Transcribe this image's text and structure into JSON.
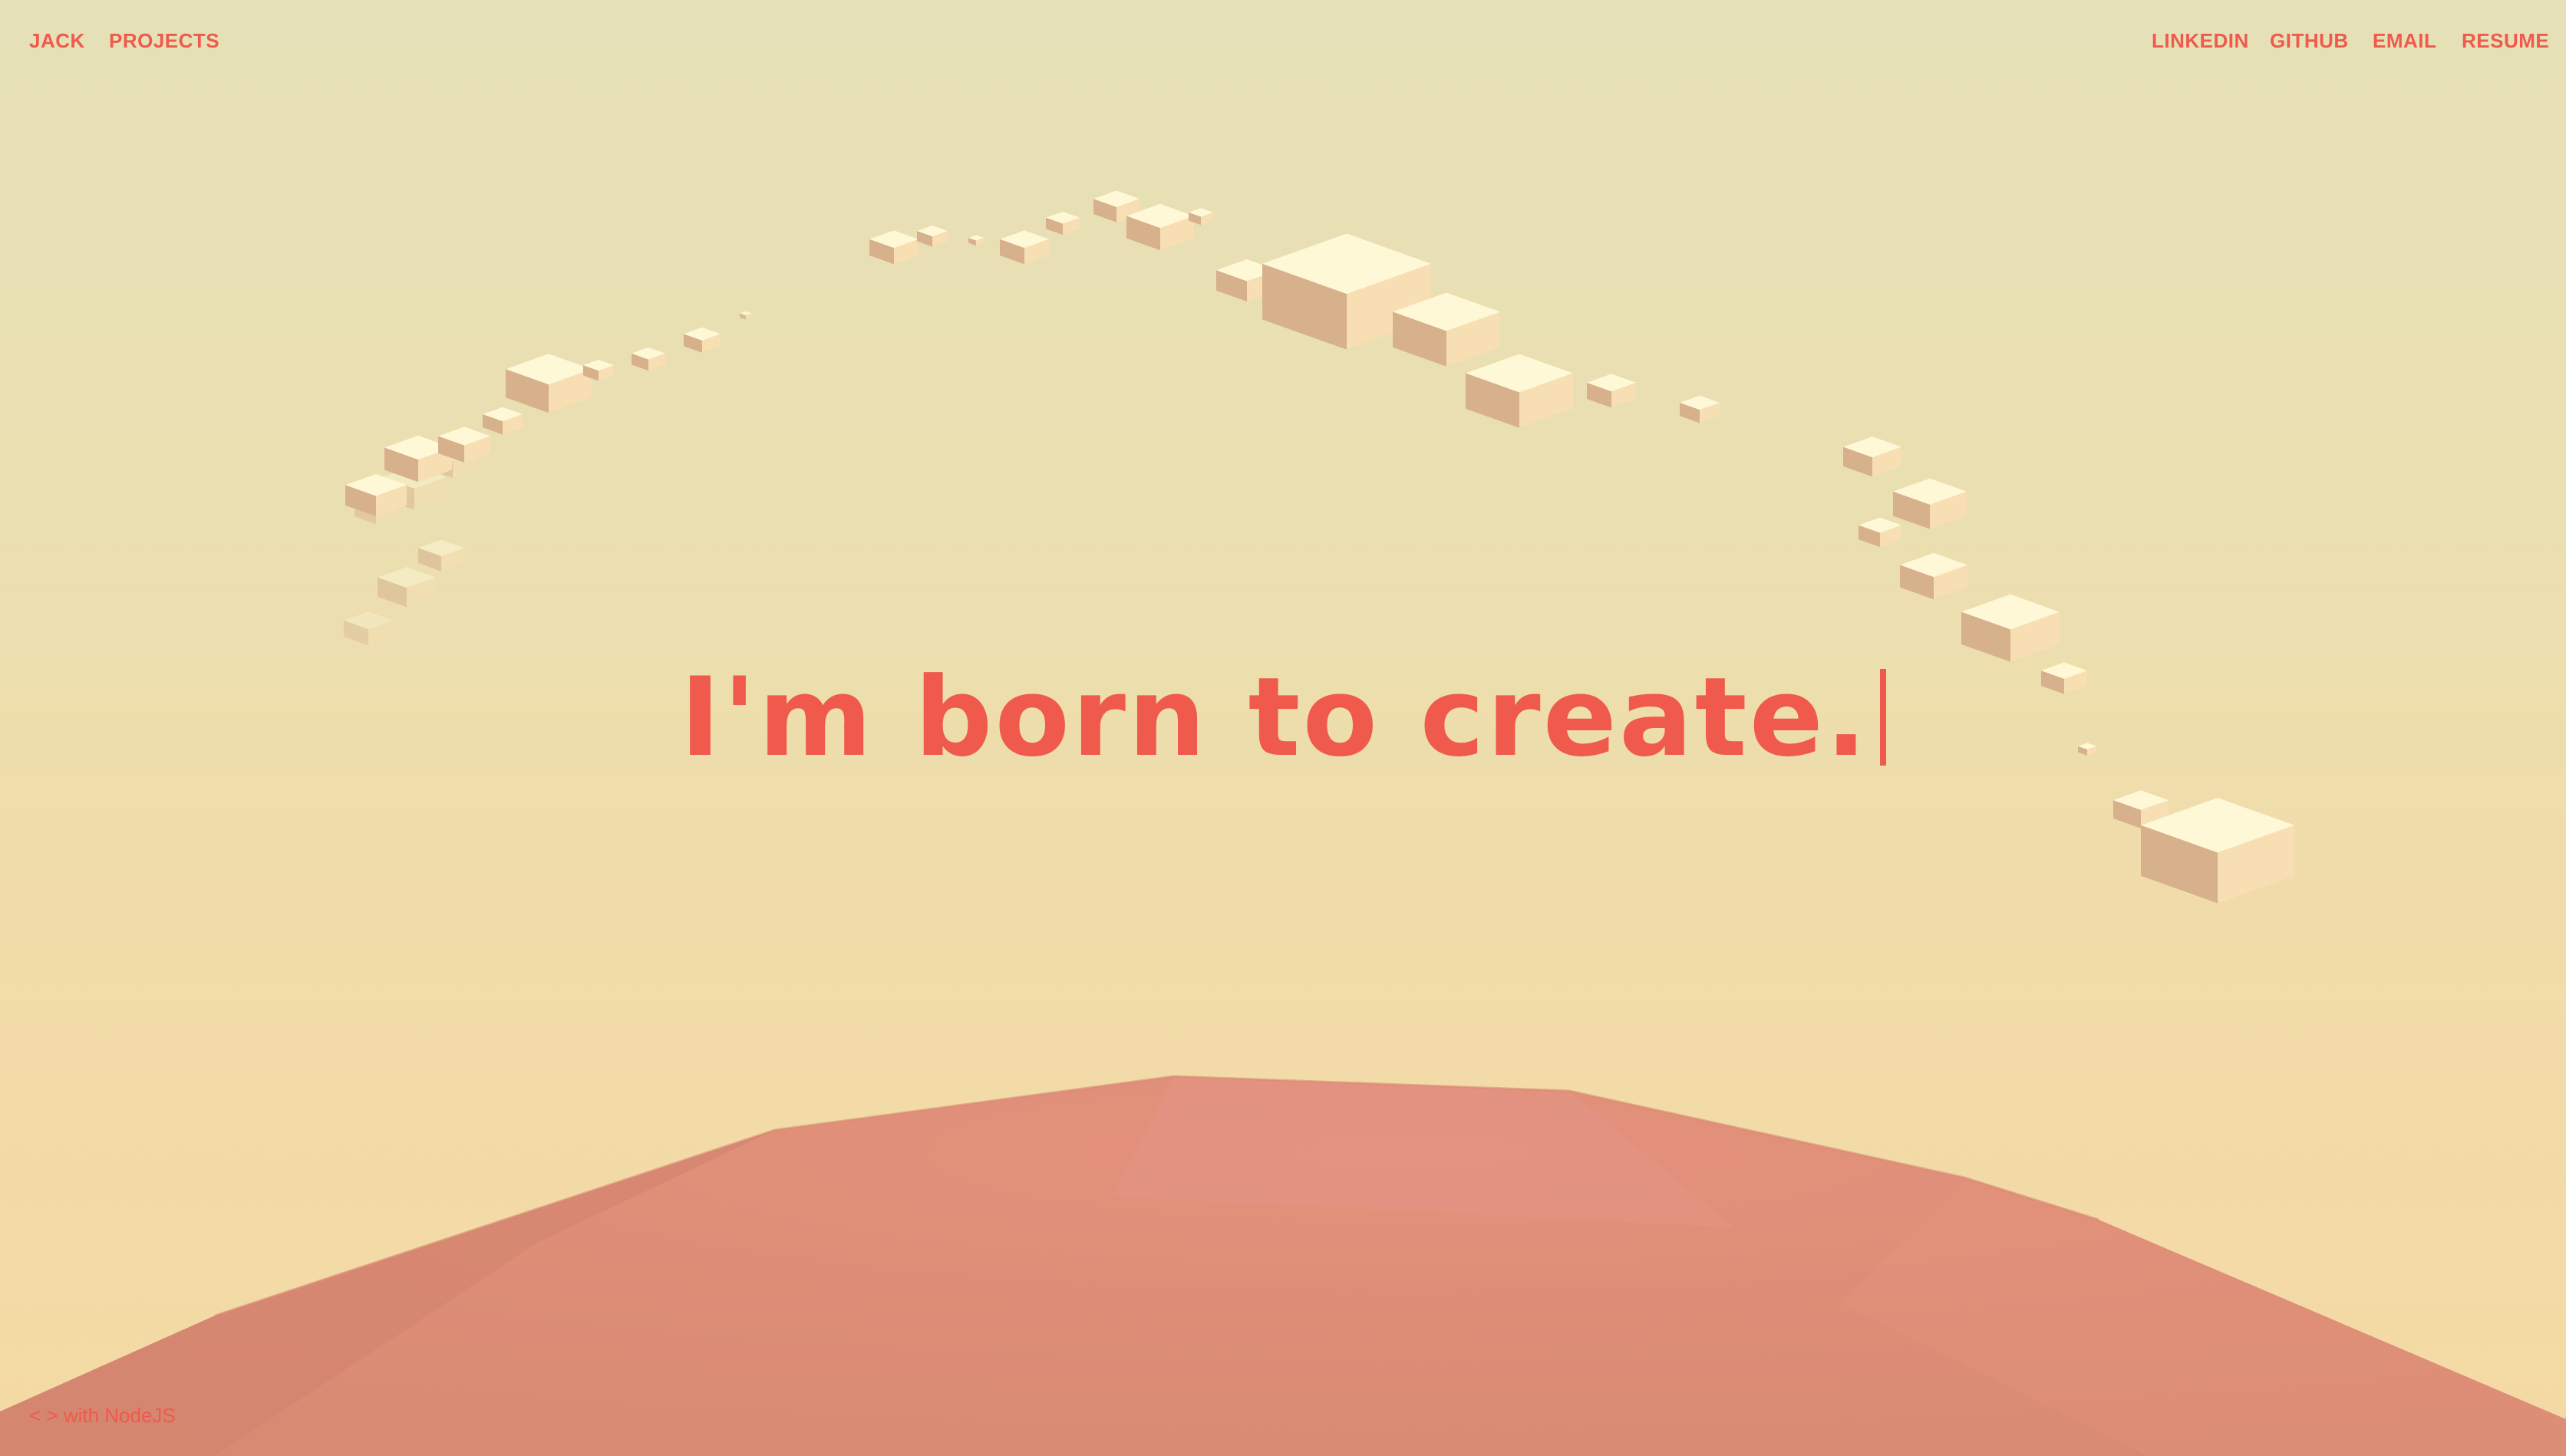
{
  "theme": {
    "accent": "#ef5a4c",
    "sky_top": "#e6e0b8",
    "sky_bottom": "#f4d9a4",
    "terrain": "#e08f79",
    "cube_light": "#fff8d6",
    "cube_mid": "#f7deb3",
    "cube_shadow": "#d7b08c"
  },
  "nav": {
    "brand": "JACK",
    "projects": "PROJECTS",
    "linkedin": "LINKEDIN",
    "github": "GITHUB",
    "email": "EMAIL",
    "resume": "RESUME"
  },
  "hero": {
    "headline": "I'm born to create."
  },
  "footer": {
    "note": "< > with NodeJS"
  },
  "icons": {
    "cursor": "text-caret-icon"
  }
}
